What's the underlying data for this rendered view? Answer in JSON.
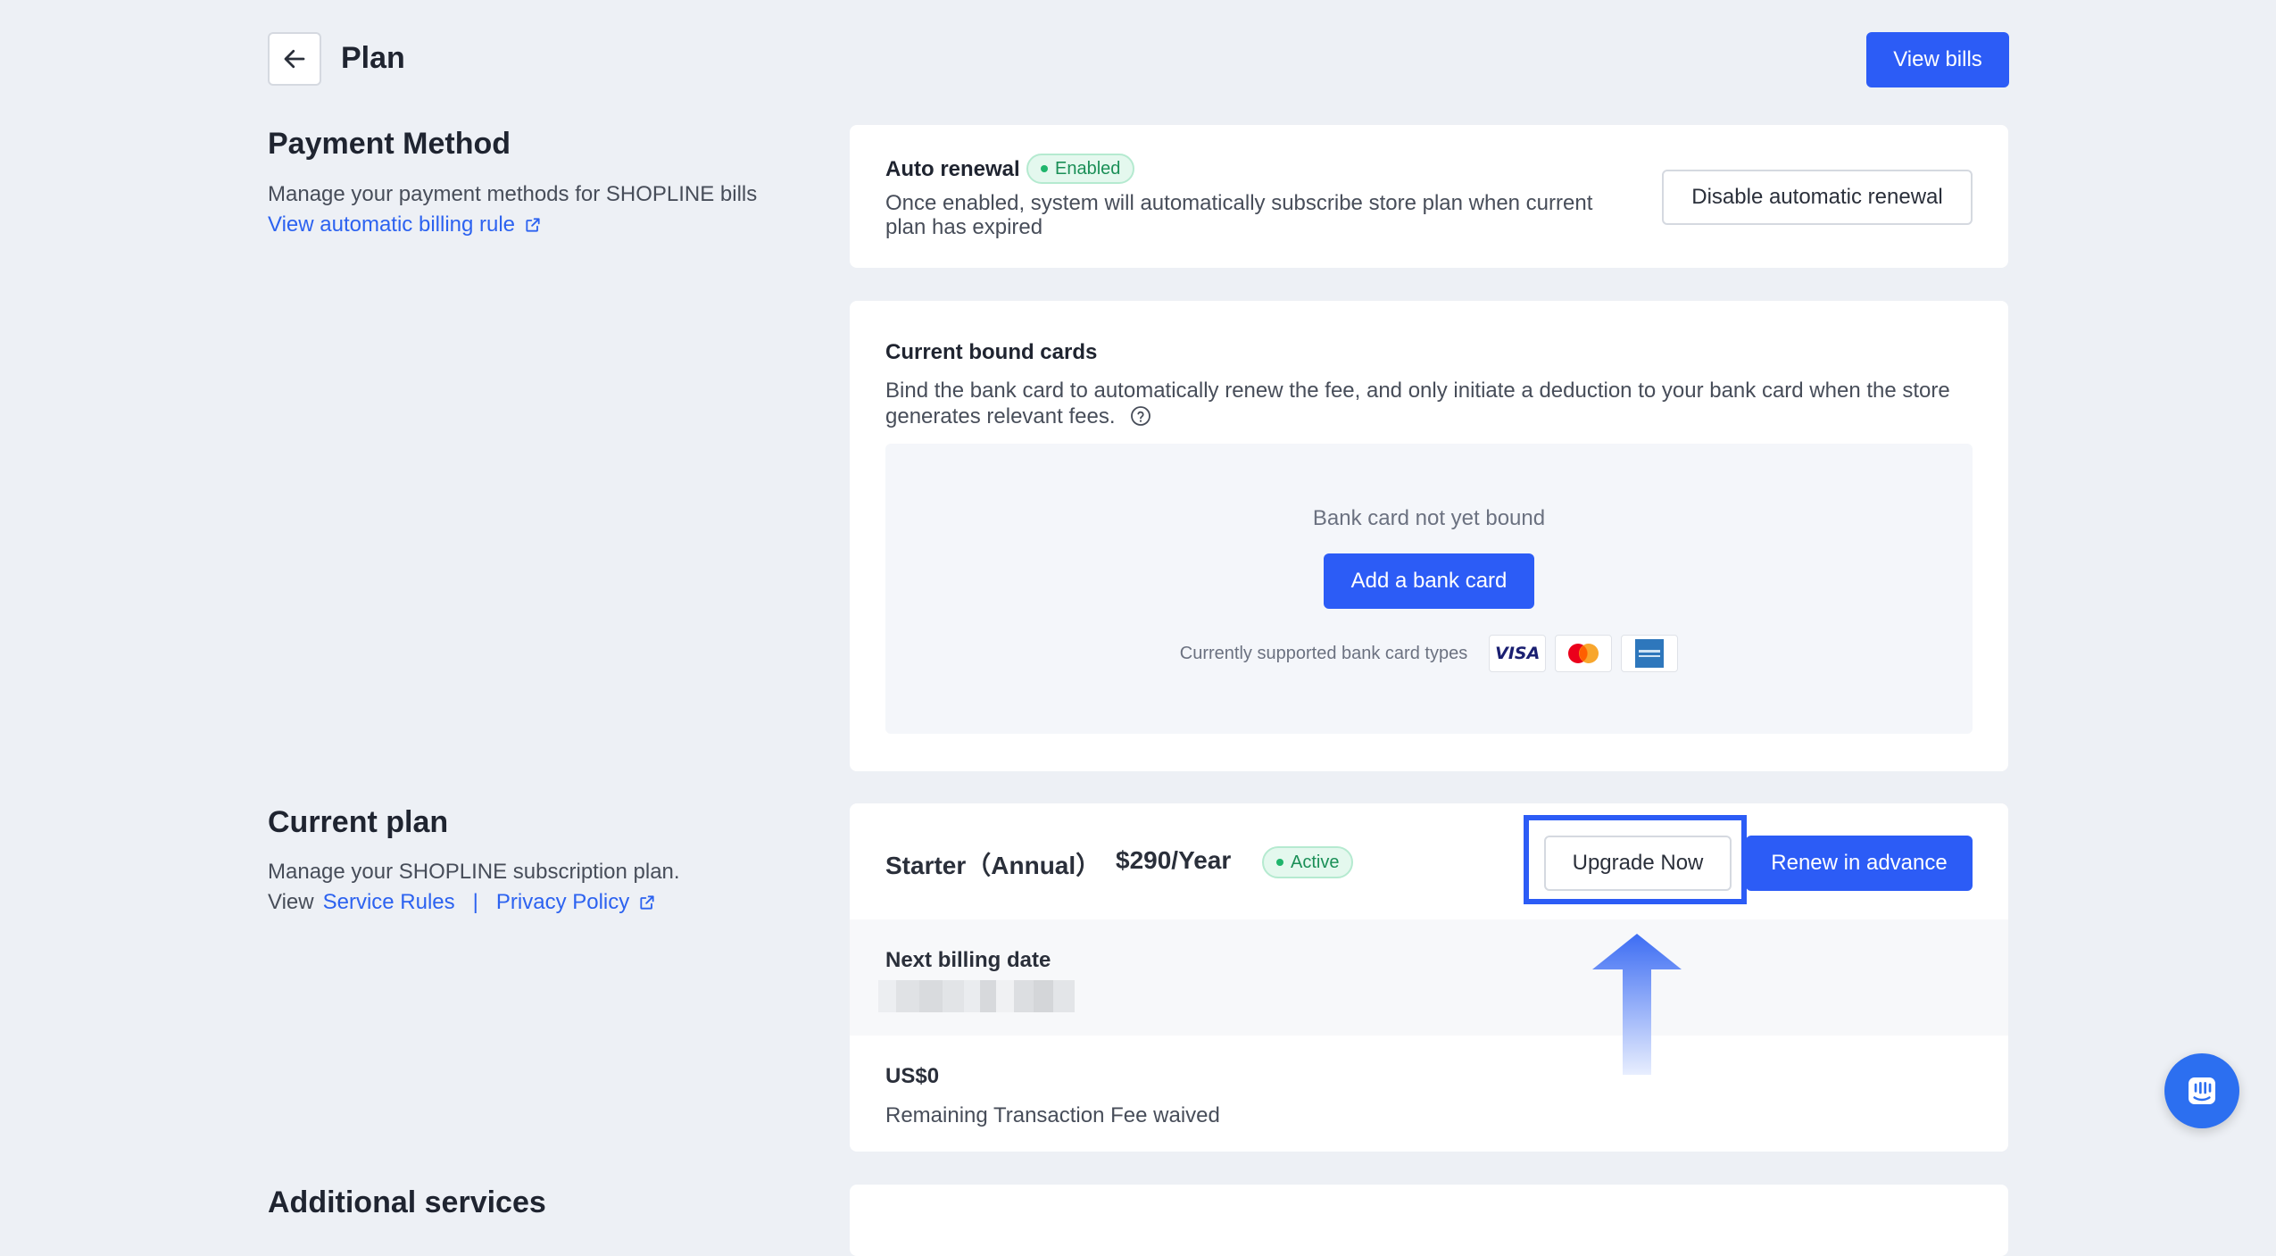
{
  "header": {
    "title": "Plan",
    "view_bills_label": "View bills"
  },
  "payment_method": {
    "title": "Payment Method",
    "description": "Manage your payment methods for SHOPLINE bills",
    "billing_rule_link": "View automatic billing rule"
  },
  "auto_renewal": {
    "title": "Auto renewal",
    "status": "Enabled",
    "description": "Once enabled, system will automatically subscribe store plan when current plan has expired",
    "disable_label": "Disable automatic renewal"
  },
  "bound_cards": {
    "title": "Current bound cards",
    "description": "Bind the bank card to automatically renew the fee, and only initiate a deduction to your bank card when the store generates relevant fees.",
    "empty_text": "Bank card not yet bound",
    "add_label": "Add a bank card",
    "supported_text": "Currently supported bank card types",
    "card_types": [
      "VISA",
      "Mastercard",
      "American Express"
    ]
  },
  "current_plan": {
    "title": "Current plan",
    "description": "Manage your SHOPLINE subscription plan.",
    "view_prefix": "View",
    "service_rules_link": "Service Rules",
    "separator": "|",
    "privacy_link": "Privacy Policy",
    "plan_name": "Starter（Annual）",
    "price": "$290/Year",
    "status": "Active",
    "upgrade_label": "Upgrade Now",
    "renew_label": "Renew in advance",
    "next_billing_label": "Next billing date",
    "fee_amount": "US$0",
    "fee_text": "Remaining Transaction Fee waived"
  },
  "additional": {
    "title": "Additional services"
  },
  "colors": {
    "primary": "#2c5cf6",
    "page_bg": "#edf0f5",
    "success": "#1fb56c",
    "highlight": "#2c5cf6"
  }
}
